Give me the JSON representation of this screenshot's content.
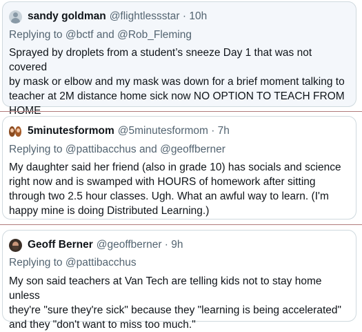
{
  "tweets": [
    {
      "name": "sandy goldman",
      "handle": "@flightlessstar · 10h",
      "reply_prefix": "Replying to",
      "mention1": "@bctf",
      "reply_and": "and",
      "mention2": "@Rob_Fleming",
      "lines": [
        "Sprayed by droplets from a student’s sneeze Day 1 that was not covered",
        "by mask or elbow and my mask was down for a brief moment talking to",
        "teacher at 2M distance home sick now NO OPTION TO TEACH FROM",
        "HOME"
      ]
    },
    {
      "name": "5minutesformom",
      "handle": "@5minutesformom · 7h",
      "reply_prefix": "Replying to",
      "mention1": "@pattibacchus",
      "reply_and": "and",
      "mention2": "@geoffberner",
      "lines": [
        "My daughter said her friend (also in grade 10) has socials and science",
        "right now and is swamped with HOURS of homework after sitting",
        "through two 2.5 hour classes. Ugh. What an awful way to learn. (I'm",
        "happy mine is doing Distributed Learning.)"
      ]
    },
    {
      "name": "Geoff Berner",
      "handle": "@geoffberner · 9h",
      "reply_prefix": "Replying to",
      "mention1": "@pattibacchus",
      "lines": [
        "My son said teachers at Van Tech are telling kids not to stay home unless",
        "they're \"sure they're sick\" because they \"learning is being accelerated\"",
        "and they \"don't want to miss too much.\""
      ]
    }
  ]
}
